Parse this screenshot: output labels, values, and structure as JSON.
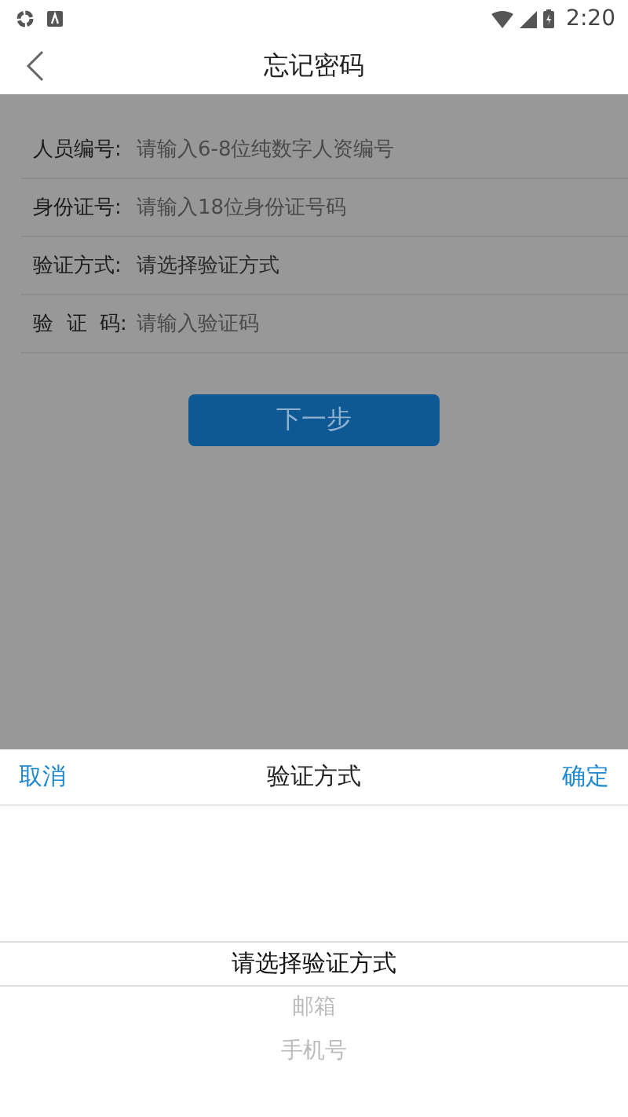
{
  "status_bar": {
    "time": "2:20"
  },
  "header": {
    "title": "忘记密码"
  },
  "form": {
    "fields": [
      {
        "kind": "input",
        "label": "人员编号:",
        "placeholder": "请输入6-8位纯数字人资编号"
      },
      {
        "kind": "input",
        "label": "身份证号:",
        "placeholder": "请输入18位身份证号码"
      },
      {
        "kind": "select",
        "label": "验证方式:",
        "value": "请选择验证方式"
      },
      {
        "kind": "input",
        "label": "验  证  码:",
        "placeholder": "请输入验证码"
      }
    ],
    "next_button": "下一步"
  },
  "picker": {
    "cancel": "取消",
    "title": "验证方式",
    "confirm": "确定",
    "options": [
      {
        "label": "请选择验证方式",
        "selected": true
      },
      {
        "label": "邮箱",
        "selected": false
      },
      {
        "label": "手机号",
        "selected": false
      }
    ]
  }
}
